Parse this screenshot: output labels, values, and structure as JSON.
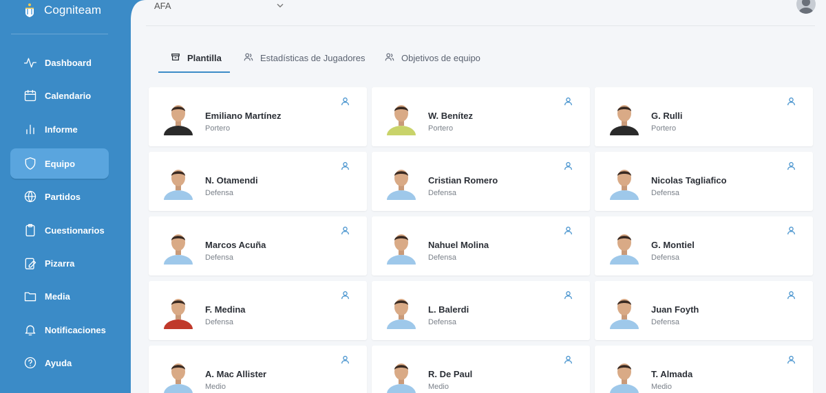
{
  "app": {
    "name": "Cogniteam"
  },
  "colors": {
    "sidebar": "#3b8bc7",
    "active_nav": "#5aa5de",
    "accent": "#3b8bc7",
    "pin_icon": "#4a95cf"
  },
  "sidebar": {
    "items": [
      {
        "label": "Dashboard",
        "icon": "activity-icon"
      },
      {
        "label": "Calendario",
        "icon": "calendar-icon"
      },
      {
        "label": "Informe",
        "icon": "bar-chart-icon"
      },
      {
        "label": "Equipo",
        "icon": "shield-icon",
        "active": true
      },
      {
        "label": "Partidos",
        "icon": "basketball-icon"
      },
      {
        "label": "Cuestionarios",
        "icon": "clipboard-icon"
      },
      {
        "label": "Pizarra",
        "icon": "edit-board-icon"
      },
      {
        "label": "Media",
        "icon": "folder-icon"
      },
      {
        "label": "Notificaciones",
        "icon": "bell-icon"
      },
      {
        "label": "Ayuda",
        "icon": "help-circle-icon"
      }
    ]
  },
  "header": {
    "organization": "AFA"
  },
  "tabs": [
    {
      "label": "Plantilla",
      "icon": "archive-icon",
      "active": true
    },
    {
      "label": "Estadísticas de Jugadores",
      "icon": "users-icon"
    },
    {
      "label": "Objetivos de equipo",
      "icon": "users-icon"
    }
  ],
  "players": [
    {
      "name": "Emiliano Martínez",
      "position": "Portero",
      "kit": "#2a2a2a"
    },
    {
      "name": "W. Benítez",
      "position": "Portero",
      "kit": "#c9d36a"
    },
    {
      "name": "G. Rulli",
      "position": "Portero",
      "kit": "#2a2a2a"
    },
    {
      "name": "N. Otamendi",
      "position": "Defensa",
      "kit": "#9ec8ea"
    },
    {
      "name": "Cristian Romero",
      "position": "Defensa",
      "kit": "#9ec8ea"
    },
    {
      "name": "Nicolas Tagliafico",
      "position": "Defensa",
      "kit": "#9ec8ea"
    },
    {
      "name": "Marcos Acuña",
      "position": "Defensa",
      "kit": "#9ec8ea"
    },
    {
      "name": "Nahuel Molina",
      "position": "Defensa",
      "kit": "#9ec8ea"
    },
    {
      "name": "G. Montiel",
      "position": "Defensa",
      "kit": "#9ec8ea"
    },
    {
      "name": "F. Medina",
      "position": "Defensa",
      "kit": "#c0392b"
    },
    {
      "name": "L. Balerdi",
      "position": "Defensa",
      "kit": "#9ec8ea"
    },
    {
      "name": "Juan Foyth",
      "position": "Defensa",
      "kit": "#9ec8ea"
    },
    {
      "name": "A. Mac Allister",
      "position": "Medio",
      "kit": "#9ec8ea"
    },
    {
      "name": "R. De Paul",
      "position": "Medio",
      "kit": "#9ec8ea"
    },
    {
      "name": "T. Almada",
      "position": "Medio",
      "kit": "#9ec8ea"
    }
  ]
}
